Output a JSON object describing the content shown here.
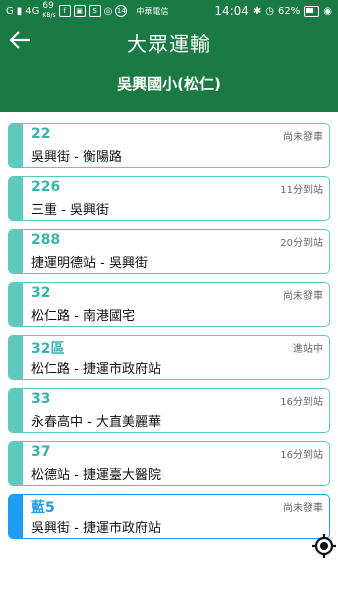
{
  "statusbar": {
    "signal": "G",
    "network": "4G",
    "speed_value": "69",
    "speed_unit": "KB/s",
    "notif_s": "S",
    "notif_14": "14",
    "carrier": "中華電信",
    "time": "14:04",
    "battery": "62%"
  },
  "header": {
    "title": "大眾運輸",
    "stop_name": "吳興國小(松仁)"
  },
  "routes": [
    {
      "number": "22",
      "status": "尚未發車",
      "desc": "吳興街 - 衡陽路"
    },
    {
      "number": "226",
      "status": "11分到站",
      "desc": "三重 - 吳興街"
    },
    {
      "number": "288",
      "status": "20分到站",
      "desc": "捷運明德站 - 吳興街"
    },
    {
      "number": "32",
      "status": "尚未發車",
      "desc": "松仁路 - 南港國宅"
    },
    {
      "number": "32區",
      "status": "進站中",
      "desc": "松仁路 - 捷運市政府站"
    },
    {
      "number": "33",
      "status": "16分到站",
      "desc": "永春高中 - 大直美麗華"
    },
    {
      "number": "37",
      "status": "16分到站",
      "desc": "松德站 - 捷運臺大醫院"
    },
    {
      "number": "藍5",
      "status": "尚未發車",
      "desc": "吳興街 - 捷運市政府站"
    }
  ],
  "colors": {
    "header_green": "#1a7a43",
    "card_teal": "#5fc9c0",
    "card_blue": "#1e9df0"
  },
  "icons": {
    "back": "arrow-left-icon",
    "locate": "crosshair-icon"
  }
}
